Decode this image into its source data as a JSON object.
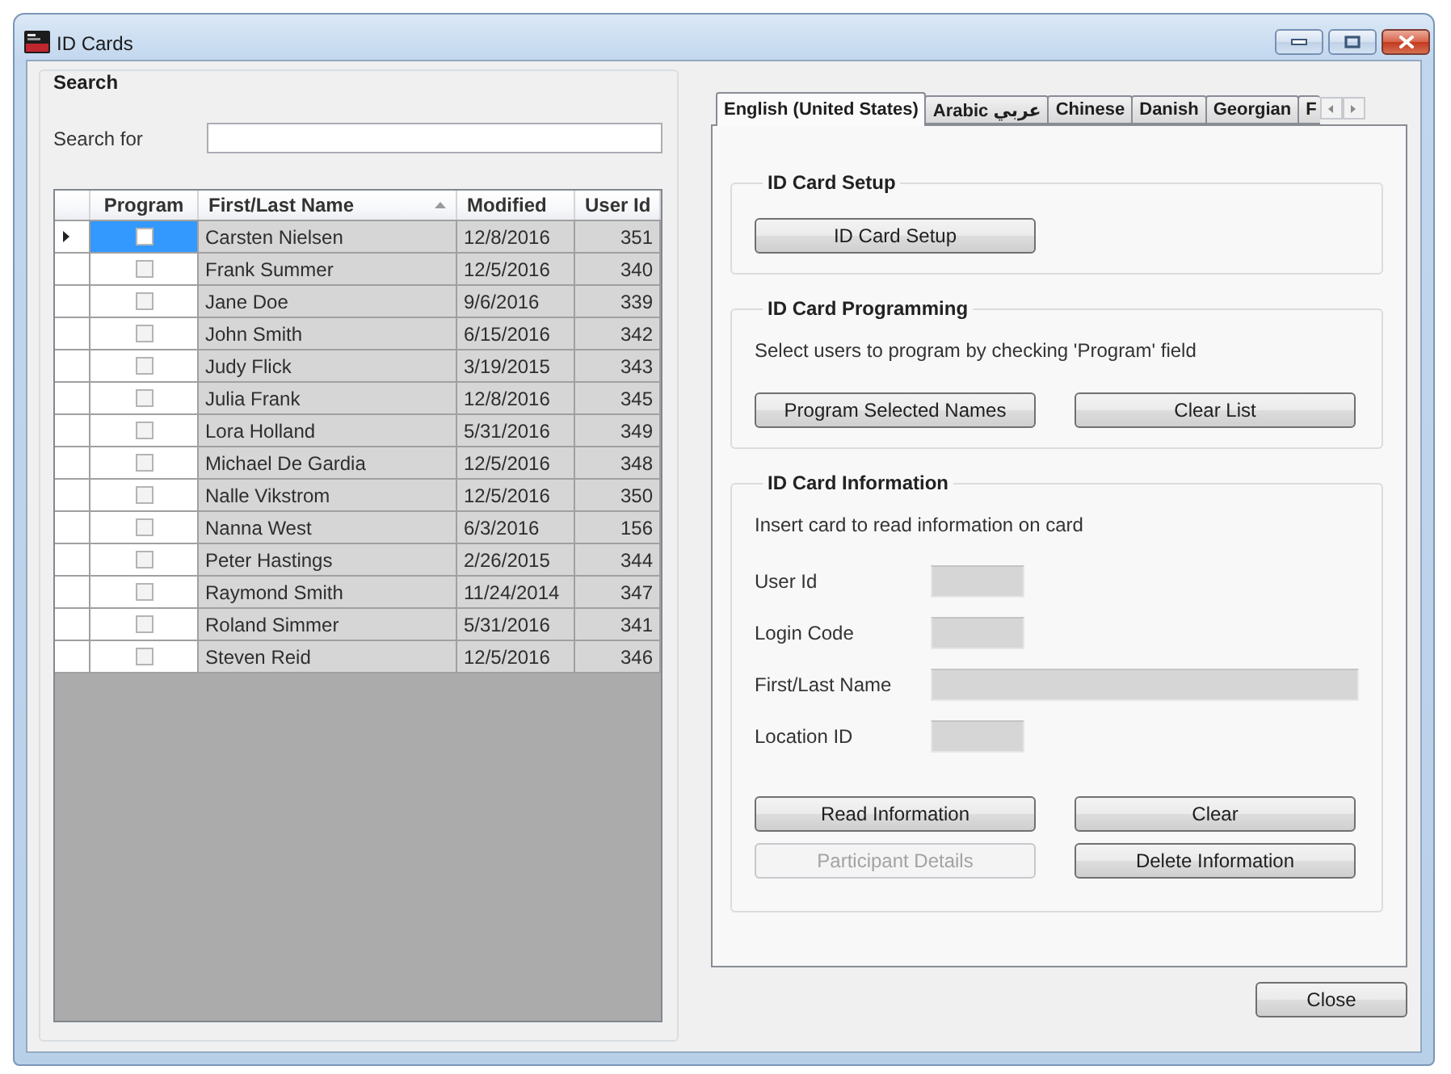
{
  "window": {
    "title": "ID Cards"
  },
  "search": {
    "title": "Search",
    "label": "Search for"
  },
  "table": {
    "columns": [
      {
        "label": "Program",
        "sorted": false
      },
      {
        "label": "First/Last Name",
        "sorted": true
      },
      {
        "label": "Modified",
        "sorted": false
      },
      {
        "label": "User Id",
        "sorted": false
      }
    ],
    "rows": [
      {
        "current": true,
        "selected": true,
        "checked": false,
        "name": "Carsten Nielsen",
        "modified": "12/8/2016",
        "user_id": "351"
      },
      {
        "current": false,
        "selected": false,
        "checked": false,
        "name": "Frank Summer",
        "modified": "12/5/2016",
        "user_id": "340"
      },
      {
        "current": false,
        "selected": false,
        "checked": false,
        "name": "Jane Doe",
        "modified": "9/6/2016",
        "user_id": "339"
      },
      {
        "current": false,
        "selected": false,
        "checked": false,
        "name": "John Smith",
        "modified": "6/15/2016",
        "user_id": "342"
      },
      {
        "current": false,
        "selected": false,
        "checked": false,
        "name": "Judy Flick",
        "modified": "3/19/2015",
        "user_id": "343"
      },
      {
        "current": false,
        "selected": false,
        "checked": false,
        "name": "Julia Frank",
        "modified": "12/8/2016",
        "user_id": "345"
      },
      {
        "current": false,
        "selected": false,
        "checked": false,
        "name": "Lora Holland",
        "modified": "5/31/2016",
        "user_id": "349"
      },
      {
        "current": false,
        "selected": false,
        "checked": false,
        "name": "Michael De Gardia",
        "modified": "12/5/2016",
        "user_id": "348"
      },
      {
        "current": false,
        "selected": false,
        "checked": false,
        "name": "Nalle Vikstrom",
        "modified": "12/5/2016",
        "user_id": "350"
      },
      {
        "current": false,
        "selected": false,
        "checked": false,
        "name": "Nanna West",
        "modified": "6/3/2016",
        "user_id": "156"
      },
      {
        "current": false,
        "selected": false,
        "checked": false,
        "name": "Peter Hastings",
        "modified": "2/26/2015",
        "user_id": "344"
      },
      {
        "current": false,
        "selected": false,
        "checked": false,
        "name": "Raymond Smith",
        "modified": "11/24/2014",
        "user_id": "347"
      },
      {
        "current": false,
        "selected": false,
        "checked": false,
        "name": "Roland Simmer",
        "modified": "5/31/2016",
        "user_id": "341"
      },
      {
        "current": false,
        "selected": false,
        "checked": false,
        "name": "Steven Reid",
        "modified": "12/5/2016",
        "user_id": "346"
      }
    ]
  },
  "tabs": [
    {
      "label": "English (United States)",
      "selected": true
    },
    {
      "label": "Arabic عربي",
      "selected": false
    },
    {
      "label": "Chinese",
      "selected": false
    },
    {
      "label": "Danish",
      "selected": false
    },
    {
      "label": "Georgian",
      "selected": false
    },
    {
      "label": "F",
      "selected": false
    }
  ],
  "tab_panel": {
    "sections": [
      {
        "title": "ID Card Setup",
        "buttons": [
          {
            "label": "ID Card Setup",
            "disabled": false
          }
        ]
      },
      {
        "title": "ID Card Programming",
        "text": "Select users to program by checking 'Program' field",
        "buttons": [
          {
            "label": "Program Selected Names",
            "disabled": false
          },
          {
            "label": "Clear List",
            "disabled": false
          }
        ]
      },
      {
        "title": "ID Card Information",
        "text": "Insert card to read information on card",
        "fields": [
          {
            "label": "User Id",
            "kind": "short",
            "disabled": true
          },
          {
            "label": "Login Code",
            "kind": "short",
            "disabled": true
          },
          {
            "label": "First/Last Name",
            "kind": "wide",
            "disabled": true
          },
          {
            "label": "Location ID",
            "kind": "short",
            "disabled": true
          }
        ],
        "buttons": [
          {
            "label": "Read Information",
            "disabled": false
          },
          {
            "label": "Clear",
            "disabled": false
          },
          {
            "label": "Participant Details",
            "disabled": true
          },
          {
            "label": "Delete Information",
            "disabled": false
          }
        ]
      }
    ]
  },
  "footer": {
    "buttons": [
      {
        "label": "Close",
        "disabled": false
      }
    ]
  }
}
